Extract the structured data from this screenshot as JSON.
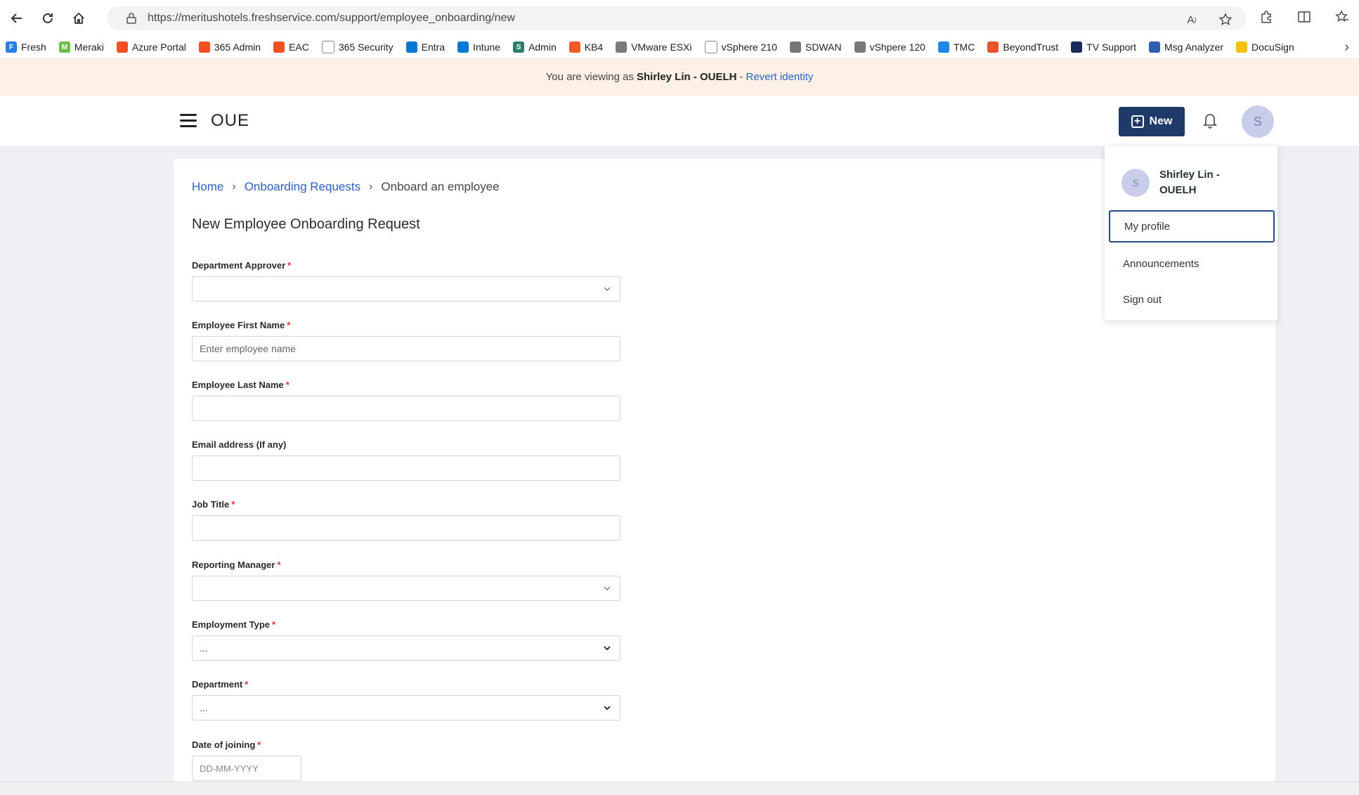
{
  "browser": {
    "url": "https://meritushotels.freshservice.com/support/employee_onboarding/new",
    "bookmarks": [
      {
        "label": "Fresh",
        "color": "#2b7de9",
        "glyph": "F"
      },
      {
        "label": "Meraki",
        "color": "#6cc04a",
        "glyph": "M"
      },
      {
        "label": "Azure Portal",
        "color": "#f25022",
        "glyph": ""
      },
      {
        "label": "365 Admin",
        "color": "#f25022",
        "glyph": ""
      },
      {
        "label": "EAC",
        "color": "#f25022",
        "glyph": ""
      },
      {
        "label": "365 Security",
        "color": "#ffffff",
        "glyph": ""
      },
      {
        "label": "Entra",
        "color": "#0078d4",
        "glyph": ""
      },
      {
        "label": "Intune",
        "color": "#0078d4",
        "glyph": ""
      },
      {
        "label": "Admin",
        "color": "#2e7d6b",
        "glyph": "S"
      },
      {
        "label": "KB4",
        "color": "#f05a28",
        "glyph": ""
      },
      {
        "label": "VMware ESXi",
        "color": "#7a7a7a",
        "glyph": ""
      },
      {
        "label": "vSphere 210",
        "color": "#ffffff",
        "glyph": ""
      },
      {
        "label": "SDWAN",
        "color": "#777777",
        "glyph": ""
      },
      {
        "label": "vShpere 120",
        "color": "#7a7a7a",
        "glyph": ""
      },
      {
        "label": "TMC",
        "color": "#1e88e5",
        "glyph": ""
      },
      {
        "label": "BeyondTrust",
        "color": "#e8552a",
        "glyph": ""
      },
      {
        "label": "TV Support",
        "color": "#1a2a5a",
        "glyph": ""
      },
      {
        "label": "Msg Analyzer",
        "color": "#2f5fb3",
        "glyph": ""
      },
      {
        "label": "DocuSign",
        "color": "#f4c20d",
        "glyph": ""
      }
    ]
  },
  "banner": {
    "prefix": "You are viewing as",
    "name": "Shirley Lin - OUELH",
    "dash": "-",
    "revert": "Revert identity"
  },
  "header": {
    "logo": "OUE",
    "new_label": "New",
    "avatar_initial": "S"
  },
  "breadcrumb": {
    "home": "Home",
    "onboarding": "Onboarding Requests",
    "current": "Onboard an employee",
    "sep": "›"
  },
  "form": {
    "title": "New Employee Onboarding Request",
    "required_mark": "*",
    "fields": {
      "department_approver": {
        "label": "Department Approver",
        "value": ""
      },
      "first_name": {
        "label": "Employee First Name",
        "placeholder": "Enter employee name"
      },
      "last_name": {
        "label": "Employee Last Name",
        "value": ""
      },
      "email": {
        "label": "Email address (If any)",
        "value": ""
      },
      "job_title": {
        "label": "Job Title",
        "value": ""
      },
      "reporting_manager": {
        "label": "Reporting Manager",
        "value": ""
      },
      "employment_type": {
        "label": "Employment Type",
        "value": "..."
      },
      "department": {
        "label": "Department",
        "value": "..."
      },
      "date_of_joining": {
        "label": "Date of joining",
        "placeholder": "DD-MM-YYYY"
      }
    }
  },
  "profile_menu": {
    "avatar_initial": "S",
    "name": "Shirley Lin - OUELH",
    "items": [
      "My profile",
      "Announcements",
      "Sign out"
    ]
  },
  "colors": {
    "brand_navy": "#1f3a68",
    "link_blue": "#2b62c5",
    "banner_bg": "#fdf0e6"
  }
}
